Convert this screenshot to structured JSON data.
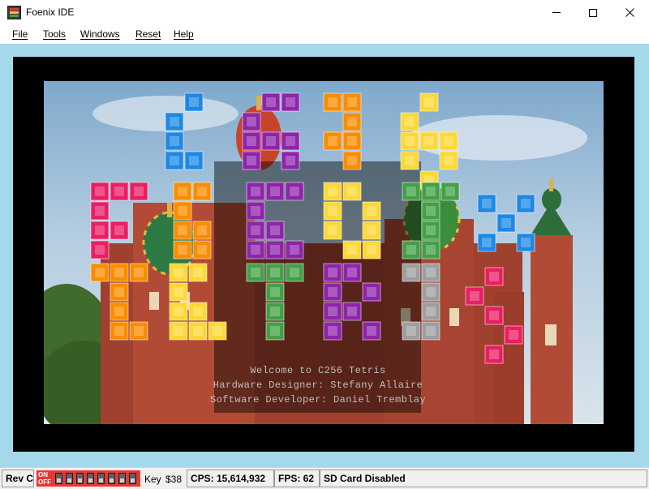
{
  "window": {
    "title": "Foenix IDE",
    "icon": "foenix-app-icon",
    "controls": [
      "minimize-icon",
      "maximize-icon",
      "close-icon"
    ]
  },
  "menu": {
    "file": "File",
    "tools": "Tools",
    "windows": "Windows",
    "reset": "Reset",
    "help": "Help"
  },
  "screen": {
    "background": "St. Basil's Cathedral photo",
    "logo_icon": "tetris-block-logo",
    "credits": {
      "line1": "Welcome to C256 Tetris",
      "line2": "Hardware Designer: Stefany Allaire",
      "line3": "Software Developer: Daniel Tremblay"
    }
  },
  "status": {
    "revision": "Rev C",
    "dip_on": "ON",
    "dip_off": "OFF",
    "dip_switch_count": 8,
    "key_label": "Key",
    "key_value": "$38",
    "cps": "CPS: 15,614,932",
    "fps": "FPS: 62",
    "sd_card": "SD Card Disabled"
  },
  "colors": {
    "screen_border": "#000000",
    "client_background": "#a6d8ec",
    "dip_switch_red": "#e53935",
    "tile_blue": "#1e88e5",
    "tile_orange": "#fb8c00",
    "tile_yellow": "#fdd835",
    "tile_purple": "#8e24aa",
    "tile_pink": "#e91e63",
    "tile_green": "#43a047",
    "tile_gray": "#9e9e9e"
  }
}
